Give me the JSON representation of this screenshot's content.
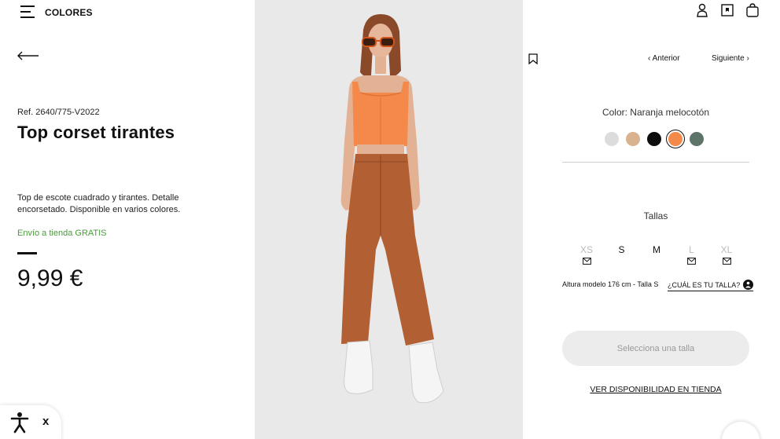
{
  "header": {
    "menu_label": "COLORES",
    "icons": [
      "menu-icon",
      "user-icon",
      "bookmark-icon",
      "bag-icon"
    ]
  },
  "product": {
    "ref": "Ref. 2640/775-V2022",
    "title": "Top corset tirantes",
    "description": "Top de escote cuadrado y tirantes. Detalle encorsetado. Disponible en varios colores.",
    "shipping": "Envío a tienda GRATIS",
    "price": "9,99 €"
  },
  "nav": {
    "prev_label": "Anterior",
    "next_label": "Siguiente"
  },
  "color": {
    "label": "Color: Naranja melocotón",
    "swatches": [
      {
        "name": "light-grey",
        "hex": "#dcdcdc",
        "selected": false
      },
      {
        "name": "beige",
        "hex": "#d9b28f",
        "selected": false
      },
      {
        "name": "black",
        "hex": "#0d0d0d",
        "selected": false
      },
      {
        "name": "orange",
        "hex": "#f48a4a",
        "selected": true
      },
      {
        "name": "green",
        "hex": "#5e7468",
        "selected": false
      }
    ]
  },
  "sizes": {
    "label": "Tallas",
    "items": [
      {
        "label": "XS",
        "available": false
      },
      {
        "label": "S",
        "available": true
      },
      {
        "label": "M",
        "available": true
      },
      {
        "label": "L",
        "available": false
      },
      {
        "label": "XL",
        "available": false
      }
    ],
    "model_info": "Altura modelo 176 cm - Talla S",
    "size_help": "¿CUÁL ES TU TALLA?"
  },
  "actions": {
    "select_size": "Selecciona una talla",
    "store_availability": "VER DISPONIBILIDAD EN TIENDA"
  },
  "accessibility": {
    "close_label": "x"
  }
}
